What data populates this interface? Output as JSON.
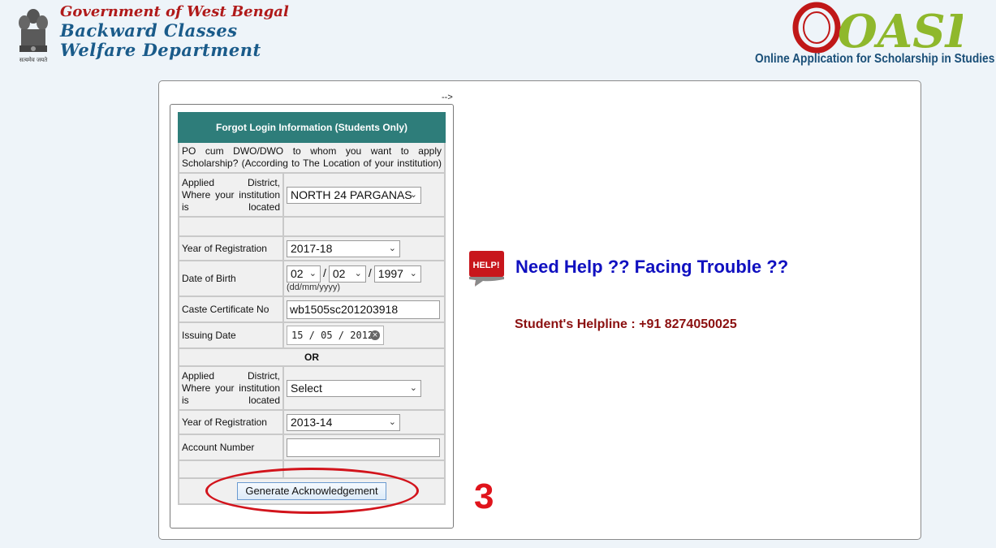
{
  "header": {
    "gov_line": "Government of West Bengal",
    "dept_line1": "Backward Classes",
    "dept_line2": "Welfare Department",
    "emblem_motto": "सत्यमेव जयते",
    "oasis_logo_text": "OASIS",
    "oasis_tagline": "Online Application for Scholarship in Studies"
  },
  "stray_text": "-->",
  "form": {
    "title": "Forgot Login Information (Students Only)",
    "intro": "PO cum DWO/DWO to whom you want to apply Scholarship? (According to The Location of your institution)",
    "section1": {
      "district_label": "Applied District, Where your institution is located",
      "district_value": "NORTH 24 PARGANAS",
      "year_label": "Year of Registration",
      "year_value": "2017-18",
      "dob_label": "Date of Birth",
      "dob_day": "02",
      "dob_month": "02",
      "dob_year": "1997",
      "dob_sep": "/",
      "dob_hint": "(dd/mm/yyyy)",
      "caste_label": "Caste Certificate No",
      "caste_value": "wb1505sc201203918",
      "issue_label": "Issuing Date",
      "issue_value": "15 / 05 / 2012"
    },
    "or_text": "OR",
    "section2": {
      "district_label": "Applied District, Where your institution is located",
      "district_value": "Select",
      "year_label": "Year of Registration",
      "year_value": "2013-14",
      "account_label": "Account Number",
      "account_value": ""
    },
    "submit_label": "Generate Acknowledgement"
  },
  "annotation": {
    "step_number": "3",
    "color": "#d2141c"
  },
  "help": {
    "icon_text": "HELP!",
    "title": "Need Help ?? Facing Trouble ??",
    "helpline": "Student's Helpline : +91 8274050025"
  },
  "colors": {
    "page_bg": "#eef4f9",
    "form_header": "#2e7d7a",
    "help_title": "#1010c0",
    "helpline": "#8b1010",
    "gov_text": "#b01a1a",
    "dept_text": "#1a5b8a"
  },
  "icons": {
    "emblem": "national-emblem-icon",
    "help": "help-speech-bubble-icon",
    "dropdown": "chevron-down-icon",
    "clear": "clear-date-icon"
  }
}
